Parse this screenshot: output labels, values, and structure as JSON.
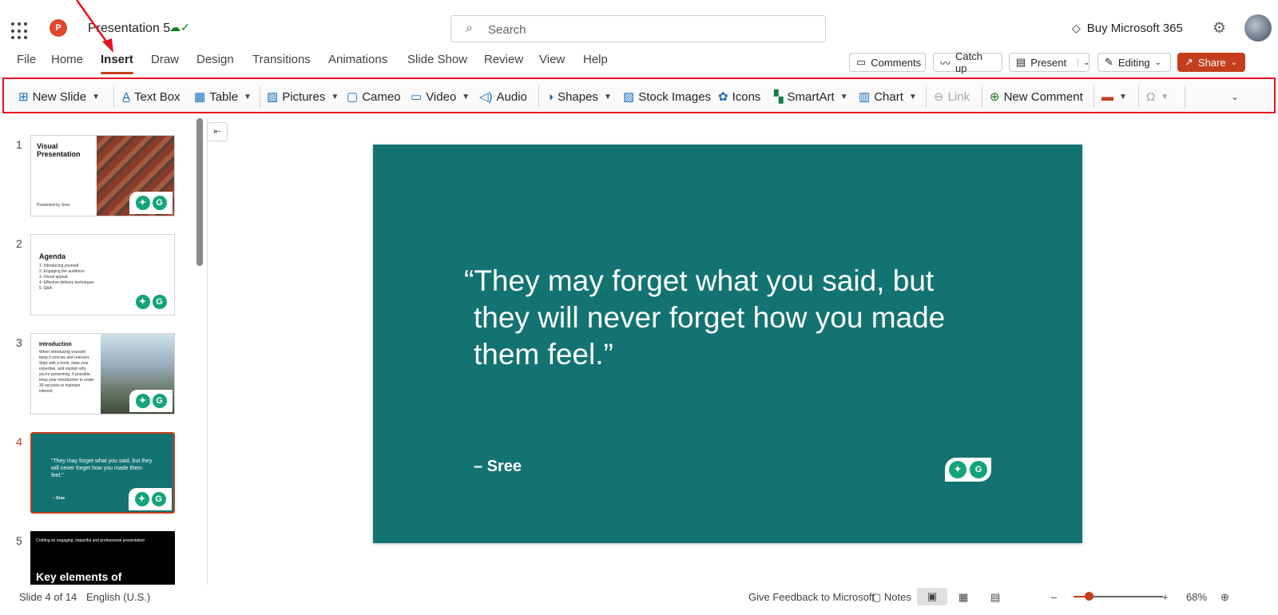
{
  "titlebar": {
    "app_icon_letter": "P",
    "doc_title": "Presentation 5",
    "save_icon": "cloud-check-icon",
    "search_placeholder": "Search",
    "buy_label": "Buy Microsoft 365",
    "settings_icon": "gear-icon"
  },
  "tabs": [
    "File",
    "Home",
    "Insert",
    "Draw",
    "Design",
    "Transitions",
    "Animations",
    "Slide Show",
    "Review",
    "View",
    "Help"
  ],
  "active_tab": "Insert",
  "header_buttons": {
    "comments": "Comments",
    "catchup": "Catch up",
    "present": "Present",
    "editing": "Editing",
    "share": "Share"
  },
  "ribbon": {
    "new_slide": "New Slide",
    "text_box": "Text Box",
    "table": "Table",
    "pictures": "Pictures",
    "cameo": "Cameo",
    "video": "Video",
    "audio": "Audio",
    "shapes": "Shapes",
    "stock_images": "Stock Images",
    "icons": "Icons",
    "smartart": "SmartArt",
    "chart": "Chart",
    "link": "Link",
    "new_comment": "New Comment"
  },
  "thumbnails": [
    {
      "num": "1",
      "title": "Visual Presentation",
      "sub": "Presented by Sree"
    },
    {
      "num": "2",
      "title": "Agenda",
      "items": [
        "1.   Introducing yourself",
        "2.   Engaging the audience",
        "3.   Visual appeal",
        "4.   Effective delivery techniques",
        "5.   Q&A"
      ]
    },
    {
      "num": "3",
      "title": "Introduction",
      "text": "When introducing yourself, keep it concise and relevant. Start with a hook, state your expertise, and explain why you're presenting. If possible, keep your introduction to under 30 seconds to maintain interest."
    },
    {
      "num": "4",
      "quote": "“They may forget what you said, but they will never forget how you made them feel.”",
      "author": "– Sree"
    },
    {
      "num": "5",
      "sub": "Crafting an engaging, impactful and professional presentation",
      "title": "Key elements of"
    }
  ],
  "slide": {
    "quote_lines": [
      "“They may forget what you said, but",
      "they will never forget how you made",
      "them feel.”"
    ],
    "author": "– Sree",
    "bg_color": "#137372"
  },
  "status": {
    "slide_info": "Slide 4 of 14",
    "language": "English (U.S.)",
    "feedback": "Give Feedback to Microsoft",
    "notes": "Notes",
    "zoom": "68%",
    "zoom_minus": "–",
    "zoom_plus": "+"
  },
  "colors": {
    "accent": "#c43e1c",
    "highlight_box": "#e81224",
    "slide_teal": "#137372"
  }
}
